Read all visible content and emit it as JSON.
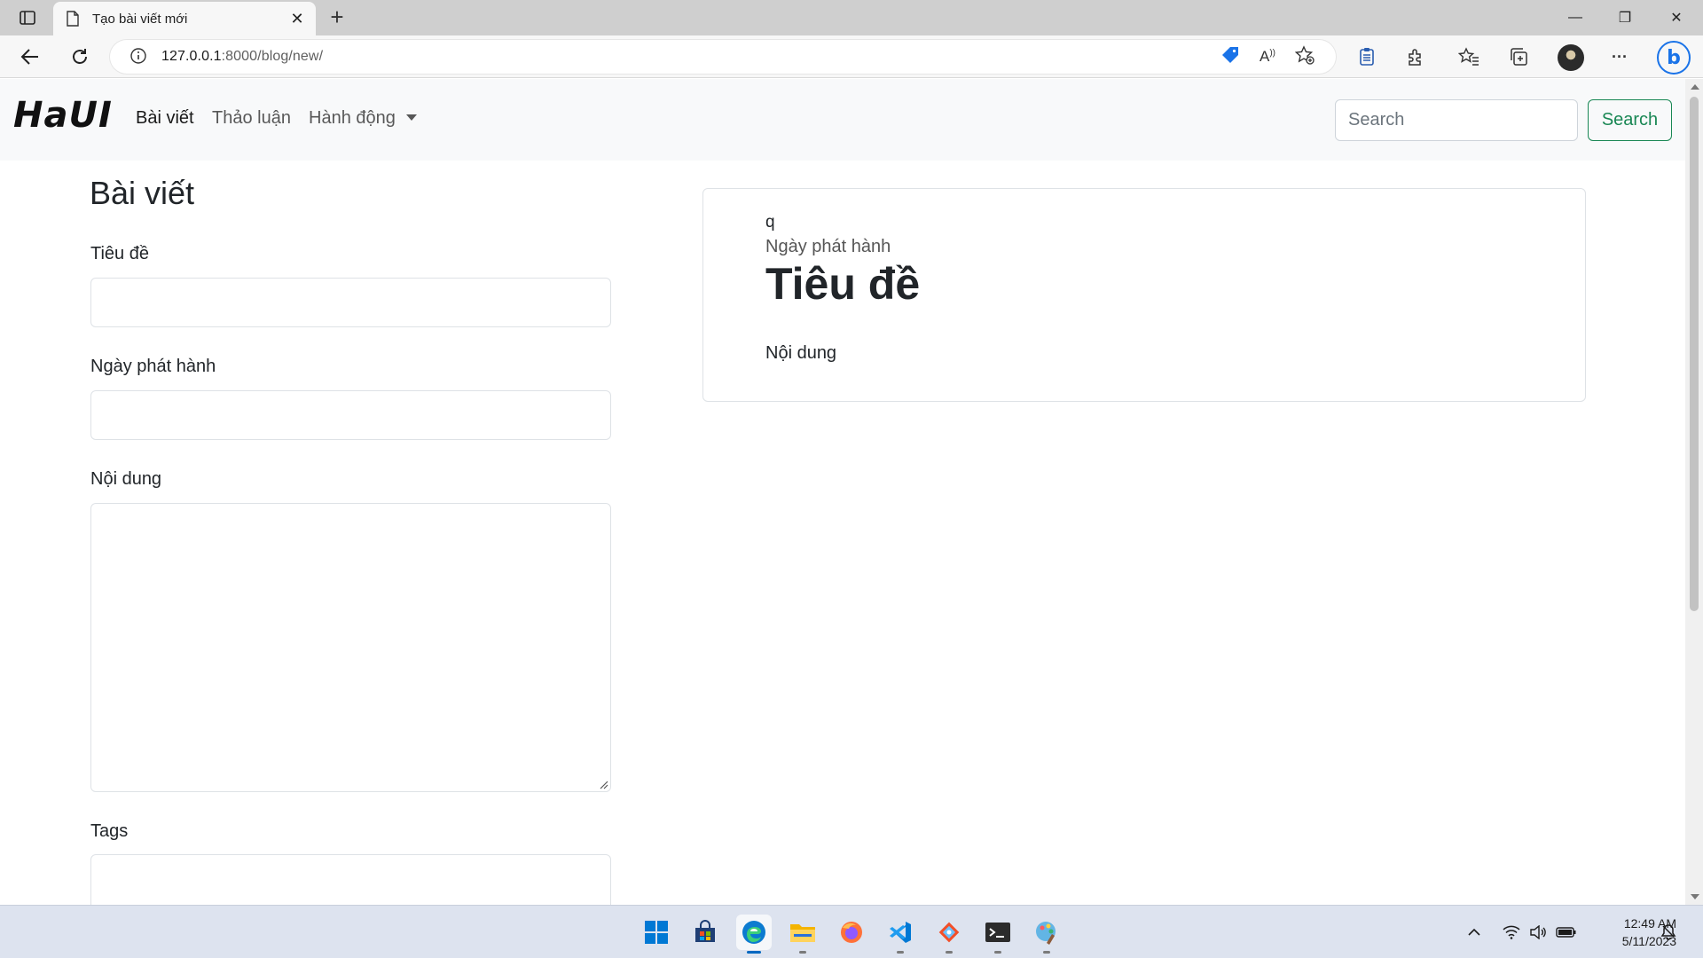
{
  "browser": {
    "tab_title": "Tạo bài viết mới",
    "tab_close": "✕",
    "new_tab": "+",
    "url_host": "127.0.0.1",
    "url_path": ":8000/blog/new/",
    "window_controls": {
      "minimize": "—",
      "maximize": "❐",
      "close": "✕"
    },
    "more_label": "···"
  },
  "navbar": {
    "brand": "HaUI",
    "links": [
      {
        "label": "Bài viết",
        "active": true
      },
      {
        "label": "Thảo luận",
        "active": false
      },
      {
        "label": "Hành động",
        "dropdown": true
      }
    ],
    "search_placeholder": "Search",
    "search_button": "Search"
  },
  "form": {
    "heading": "Bài viết",
    "fields": {
      "title_label": "Tiêu đề",
      "date_label": "Ngày phát hành",
      "content_label": "Nội dung",
      "tags_label": "Tags"
    }
  },
  "preview": {
    "q": "q",
    "date": "Ngày phát hành",
    "title": "Tiêu đề",
    "content": "Nội dung"
  },
  "taskbar": {
    "apps": [
      "start-icon",
      "store-icon",
      "edge-icon",
      "file-explorer-icon",
      "firefox-icon",
      "vscode-icon",
      "git-icon",
      "terminal-icon",
      "paint-icon"
    ],
    "time": "12:49 AM",
    "date": "5/11/2023"
  },
  "colors": {
    "navbar_bg": "#f8f9fa",
    "search_button": "#198754",
    "taskbar_bg": "#dde3ef",
    "edge_accent": "#0067c0"
  }
}
